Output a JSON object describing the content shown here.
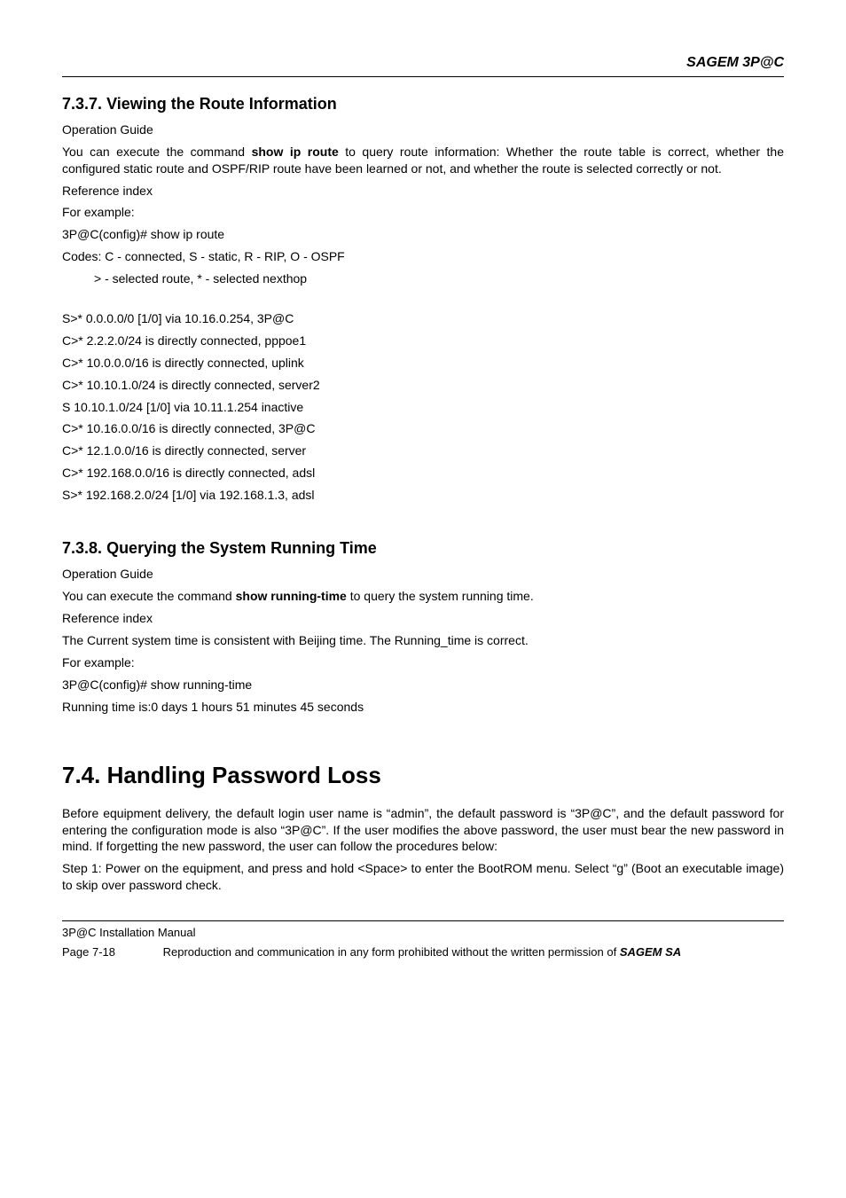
{
  "brand": "SAGEM 3P@C",
  "sec737": {
    "number": "7.3.7.",
    "title": "Viewing the Route Information",
    "opguide_label": "Operation Guide",
    "para1_pre": "You can execute the command ",
    "para1_bold": "show ip route",
    "para1_post": " to query route information: Whether the route table is correct, whether the configured static route and OSPF/RIP route have been learned or not, and whether the route is selected correctly or not.",
    "refindex": "Reference index",
    "forexample": "For example:",
    "cmd": "3P@C(config)# show ip route",
    "codes": "Codes:  C - connected, S - static, R - RIP, O - OSPF",
    "selected": "> - selected route, * - selected nexthop",
    "routes": [
      "S>* 0.0.0.0/0 [1/0] via 10.16.0.254, 3P@C",
      "C>* 2.2.2.0/24 is directly connected, pppoe1",
      "C>* 10.0.0.0/16 is directly connected, uplink",
      "C>* 10.10.1.0/24 is directly connected, server2",
      "S   10.10.1.0/24 [1/0] via 10.11.1.254 inactive",
      "C>* 10.16.0.0/16 is directly connected, 3P@C",
      "C>* 12.1.0.0/16 is directly connected, server",
      "C>* 192.168.0.0/16 is directly connected, adsl",
      "S>* 192.168.2.0/24 [1/0] via 192.168.1.3, adsl"
    ]
  },
  "sec738": {
    "number": "7.3.8.",
    "title": "Querying the System Running Time",
    "opguide_label": "Operation Guide",
    "para1_pre": "You can execute the command ",
    "para1_bold": "show running-time",
    "para1_post": " to query the system running time.",
    "refindex": "Reference index",
    "current": "The Current system time is consistent with Beijing time. The Running_time is correct.",
    "forexample": "For example:",
    "cmd": "3P@C(config)# show running-time",
    "output": "Running time is:0 days 1 hours 51 minutes 45 seconds"
  },
  "sec74": {
    "number": "7.4.",
    "title": "Handling Password Loss",
    "para1": "Before equipment delivery, the default login user name is “admin”, the default password is “3P@C”, and the default password for entering the configuration mode is also “3P@C”. If the user modifies the above password, the user must bear the new password in mind. If forgetting the new password, the user can follow the procedures below:",
    "para2": "Step 1: Power on the equipment, and press and hold <Space> to enter the BootROM menu. Select “g” (Boot an executable image) to skip over password check."
  },
  "footer": {
    "manual": "3P@C Installation Manual",
    "page": "Page 7-18",
    "repro_pre": "Reproduction and communication in any form prohibited without the written permission of ",
    "repro_bold": "SAGEM SA"
  }
}
